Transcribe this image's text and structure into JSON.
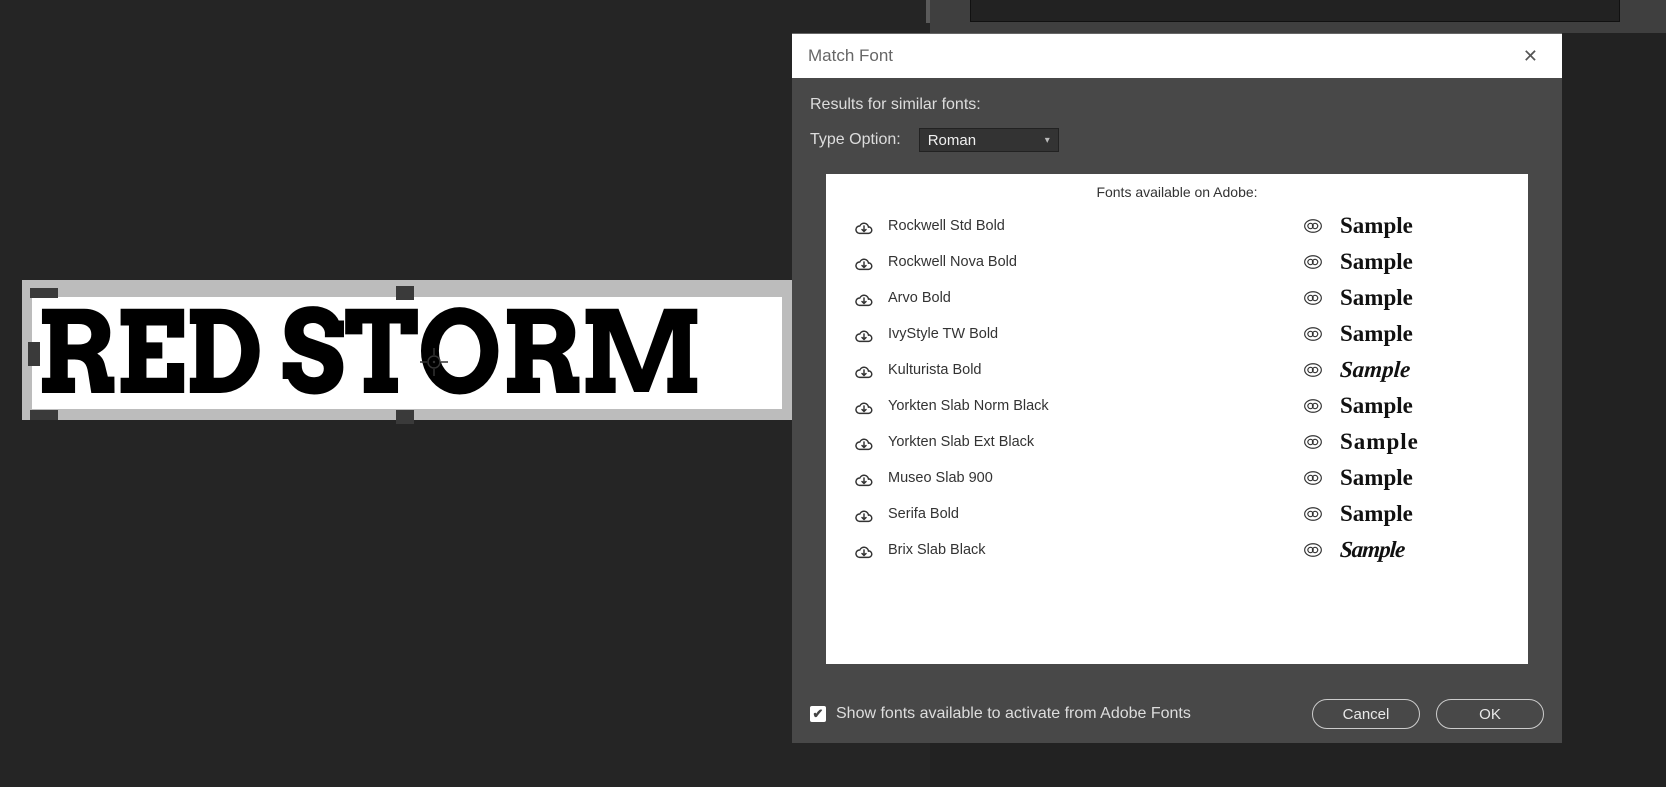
{
  "canvas": {
    "sample_text": "RED STORM"
  },
  "dialog": {
    "title": "Match Font",
    "results_label": "Results for similar fonts:",
    "type_option_label": "Type Option:",
    "type_option_value": "Roman",
    "panel_header": "Fonts available on Adobe:",
    "fonts": [
      {
        "name": "Rockwell Std Bold",
        "sample": "Sample"
      },
      {
        "name": "Rockwell Nova Bold",
        "sample": "Sample"
      },
      {
        "name": "Arvo Bold",
        "sample": "Sample"
      },
      {
        "name": "IvyStyle TW Bold",
        "sample": "Sample"
      },
      {
        "name": "Kulturista Bold",
        "sample": "Sample"
      },
      {
        "name": "Yorkten Slab Norm Black",
        "sample": "Sample"
      },
      {
        "name": "Yorkten Slab Ext Black",
        "sample": "Sample"
      },
      {
        "name": "Museo Slab 900",
        "sample": "Sample"
      },
      {
        "name": "Serifa Bold",
        "sample": "Sample"
      },
      {
        "name": "Brix Slab Black",
        "sample": "Sample"
      }
    ],
    "checkbox_label": "Show fonts available to activate from Adobe Fonts",
    "checkbox_checked": true,
    "cancel_label": "Cancel",
    "ok_label": "OK"
  }
}
